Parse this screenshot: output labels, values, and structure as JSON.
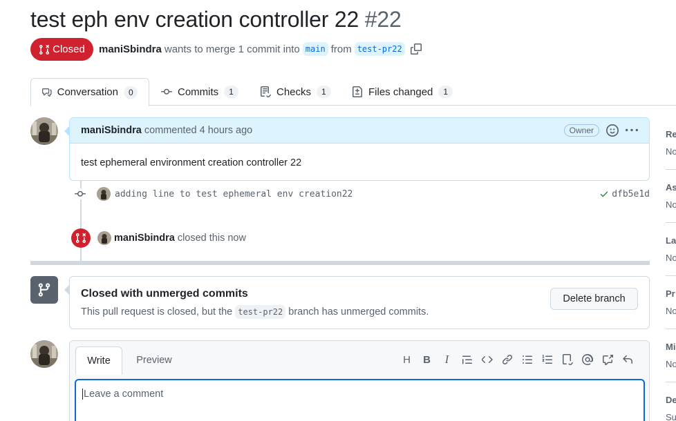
{
  "pr": {
    "title": "test eph env creation controller 22",
    "number": "#22",
    "state": "Closed",
    "author": "maniSbindra",
    "meta_text": "wants to merge 1 commit into",
    "base_branch": "main",
    "from_text": "from",
    "head_branch": "test-pr22"
  },
  "tabs": [
    {
      "label": "Conversation",
      "count": "0"
    },
    {
      "label": "Commits",
      "count": "1"
    },
    {
      "label": "Checks",
      "count": "1"
    },
    {
      "label": "Files changed",
      "count": "1"
    }
  ],
  "comment": {
    "author": "maniSbindra",
    "action": "commented 4 hours ago",
    "badge": "Owner",
    "body": "test ephemeral environment creation controller 22"
  },
  "commit": {
    "message": "adding line to test ephemeral env creation22",
    "sha": "dfb5e1d"
  },
  "closed_event": {
    "author": "maniSbindra",
    "text": "closed this now"
  },
  "merge_box": {
    "title": "Closed with unmerged commits",
    "desc_before": "This pull request is closed, but the",
    "branch": "test-pr22",
    "desc_after": "branch has unmerged commits.",
    "delete_button": "Delete branch"
  },
  "editor": {
    "tab_write": "Write",
    "tab_preview": "Preview",
    "placeholder": "Leave a comment"
  },
  "sidebar": {
    "labels": [
      "Re",
      "As",
      "La",
      "Pr",
      "Mi",
      "De"
    ],
    "values": [
      "No",
      "No",
      "No",
      "No",
      "No",
      "Su"
    ]
  },
  "colors": {
    "closed_red": "#cf222e",
    "accent_blue": "#0969da",
    "comment_header_bg": "#ddf4ff",
    "success_green": "#1a7f37"
  }
}
